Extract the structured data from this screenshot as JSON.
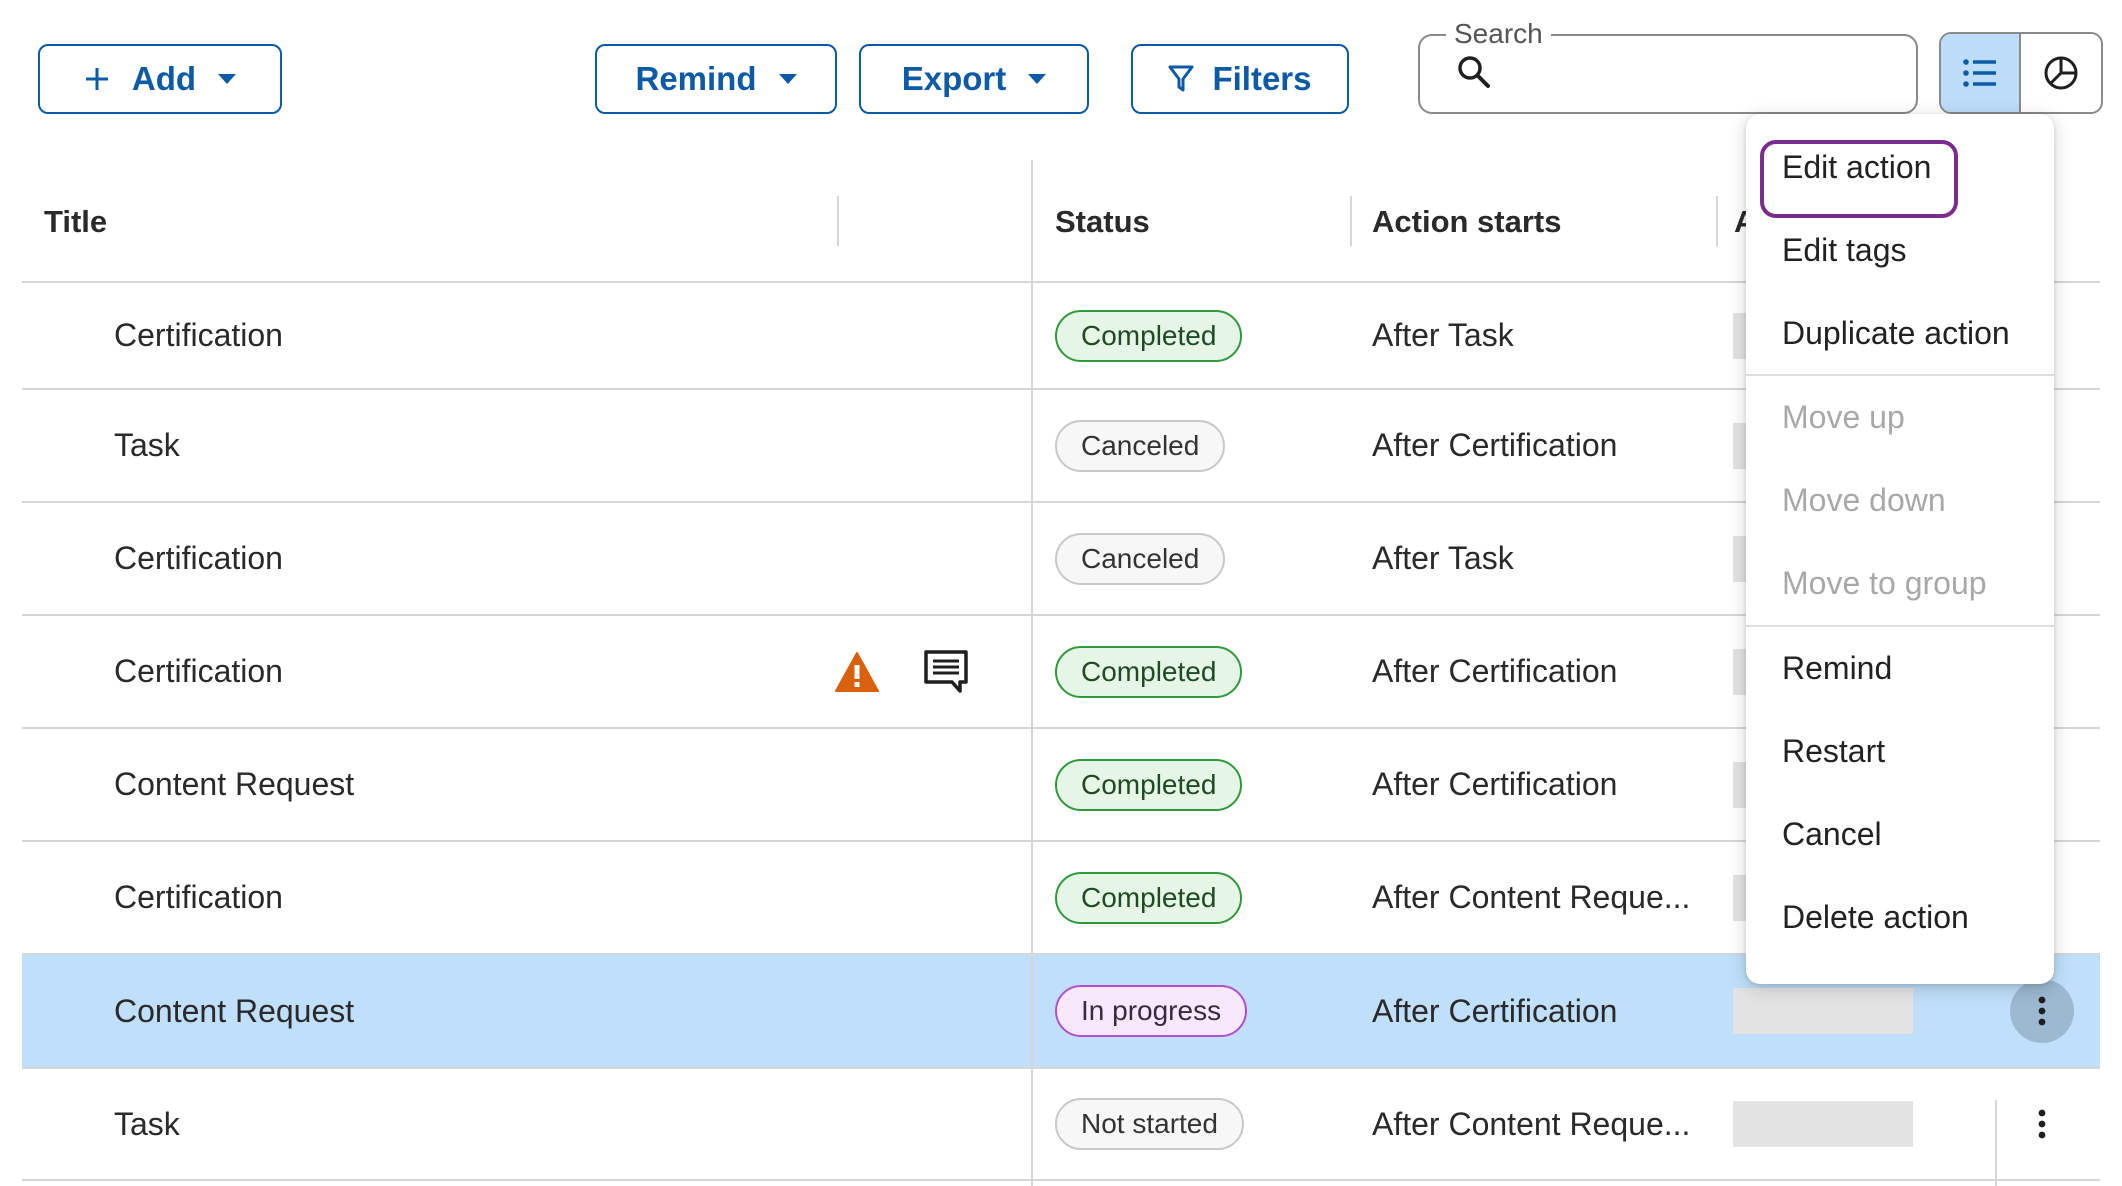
{
  "toolbar": {
    "add_label": "Add",
    "remind_label": "Remind",
    "export_label": "Export",
    "filters_label": "Filters"
  },
  "search": {
    "label": "Search",
    "value": ""
  },
  "view_toggle": {
    "active": "list"
  },
  "table": {
    "columns": {
      "title": "Title",
      "status": "Status",
      "action_starts": "Action starts",
      "assignee_partial": "As"
    },
    "rows": [
      {
        "title": "Certification",
        "status": "Completed",
        "status_kind": "completed",
        "action_starts": "After Task"
      },
      {
        "title": "Task",
        "status": "Canceled",
        "status_kind": "canceled",
        "action_starts": "After Certification"
      },
      {
        "title": "Certification",
        "status": "Canceled",
        "status_kind": "canceled",
        "action_starts": "After Task"
      },
      {
        "title": "Certification",
        "status": "Completed",
        "status_kind": "completed",
        "action_starts": "After Certification",
        "has_warning": true,
        "has_comment": true
      },
      {
        "title": "Content Request",
        "status": "Completed",
        "status_kind": "completed",
        "action_starts": "After Certification"
      },
      {
        "title": "Certification",
        "status": "Completed",
        "status_kind": "completed",
        "action_starts": "After Content Reque..."
      },
      {
        "title": "Content Request",
        "status": "In progress",
        "status_kind": "inprogress",
        "action_starts": "After Certification",
        "selected": true
      },
      {
        "title": "Task",
        "status": "Not started",
        "status_kind": "notstarted",
        "action_starts": "After Content Reque..."
      }
    ]
  },
  "menu": {
    "items": [
      {
        "label": "Edit action",
        "enabled": true,
        "focused": true
      },
      {
        "label": "Edit tags",
        "enabled": true
      },
      {
        "label": "Duplicate action",
        "enabled": true
      },
      {
        "label": "Move up",
        "enabled": false
      },
      {
        "label": "Move down",
        "enabled": false
      },
      {
        "label": "Move to group",
        "enabled": false
      },
      {
        "label": "Remind",
        "enabled": true
      },
      {
        "label": "Restart",
        "enabled": true
      },
      {
        "label": "Cancel",
        "enabled": true
      },
      {
        "label": "Delete action",
        "enabled": true
      }
    ]
  },
  "colors": {
    "primary": "#0d5aa7",
    "selected_row": "#bfdffa",
    "focus_ring": "#7b2d8e",
    "warning": "#d9600c",
    "completed_border": "#2e9a3a",
    "inprogress_border": "#b44ecb"
  },
  "icons": {
    "add": "plus-icon",
    "caret": "caret-down-icon",
    "filter": "filter-icon",
    "search": "search-icon",
    "list_view": "list-icon",
    "chart_view": "pie-chart-icon",
    "warning": "warning-icon",
    "comment": "comment-icon",
    "row_menu": "more-vertical-icon"
  }
}
